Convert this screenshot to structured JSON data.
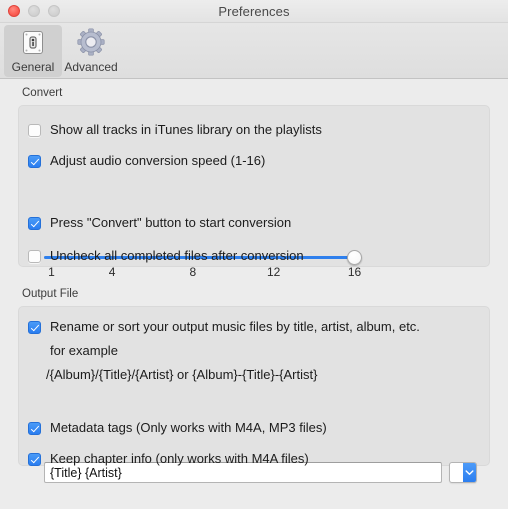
{
  "window": {
    "title": "Preferences",
    "traffic_lights": [
      {
        "name": "close",
        "color": "#fc5f55",
        "active": true
      },
      {
        "name": "minimize",
        "color": "#d2d2d2",
        "active": false
      },
      {
        "name": "maximize",
        "color": "#d2d2d2",
        "active": false
      }
    ]
  },
  "toolbar": {
    "items": [
      {
        "label": "General",
        "icon": "general-switch-icon",
        "selected": true
      },
      {
        "label": "Advanced",
        "icon": "gear-icon",
        "selected": false
      }
    ]
  },
  "convert": {
    "group_label": "Convert",
    "show_all_tracks": {
      "label": "Show all tracks in iTunes library on the playlists",
      "checked": false
    },
    "adjust_speed": {
      "label": "Adjust audio conversion speed (1-16)",
      "checked": true
    },
    "speed_slider": {
      "min": 1,
      "max": 16,
      "value": 16,
      "ticks": [
        "1",
        "4",
        "8",
        "12",
        "16"
      ],
      "tick_values": [
        1,
        4,
        8,
        12,
        16
      ],
      "accent": "#2f80ed"
    },
    "press_convert": {
      "label": "Press \"Convert\" button to start conversion",
      "checked": true
    },
    "uncheck_completed": {
      "label": "Uncheck all completed files after conversion",
      "checked": false
    }
  },
  "output_file": {
    "group_label": "Output File",
    "rename_sort": {
      "label": "Rename or sort your output music files by title, artist, album, etc.",
      "checked": true
    },
    "example_heading": "for example",
    "example_pattern": "/{Album}/{Title}/{Artist} or {Album}-{Title}-{Artist}",
    "pattern_field": {
      "value": "{Title} {Artist}",
      "placeholder": ""
    },
    "pattern_popup": {
      "icon": "chevron-down-icon",
      "accent": "#2b7ef0"
    },
    "metadata_tags": {
      "label": "Metadata tags (Only works with M4A, MP3 files)",
      "checked": true
    },
    "keep_chapter_info": {
      "label": "Keep chapter info (only works with  M4A files)",
      "checked": true
    }
  }
}
